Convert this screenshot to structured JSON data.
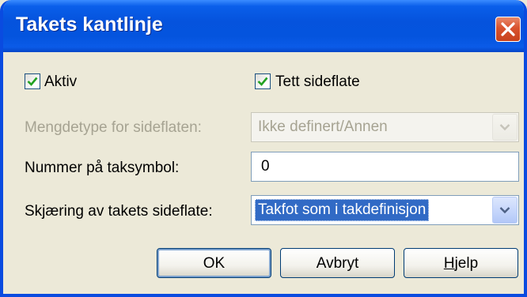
{
  "window": {
    "title": "Takets kantlinje",
    "close_icon": "close-icon"
  },
  "checkboxes": {
    "aktiv": {
      "label": "Aktiv",
      "checked": true
    },
    "tett_sideflate": {
      "label": "Tett sideflate",
      "checked": true
    }
  },
  "fields": {
    "mengdetype": {
      "label": "Mengdetype for sideflaten:",
      "value": "Ikke definert/Annen",
      "enabled": false
    },
    "nummer": {
      "label": "Nummer på taksymbol:",
      "value": "0"
    },
    "skjaering": {
      "label": "Skjæring av takets sideflate:",
      "value": "Takfot som i takdefinisjon",
      "enabled": true
    }
  },
  "buttons": {
    "ok": "OK",
    "cancel": "Avbryt",
    "help_mnemonic": "H",
    "help_rest": "jelp"
  },
  "colors": {
    "titlebar": "#0553DD",
    "dialog_bg": "#ECE9D8",
    "close_button": "#D9532E",
    "selection": "#316AC5",
    "disabled_text": "#A6A392"
  }
}
